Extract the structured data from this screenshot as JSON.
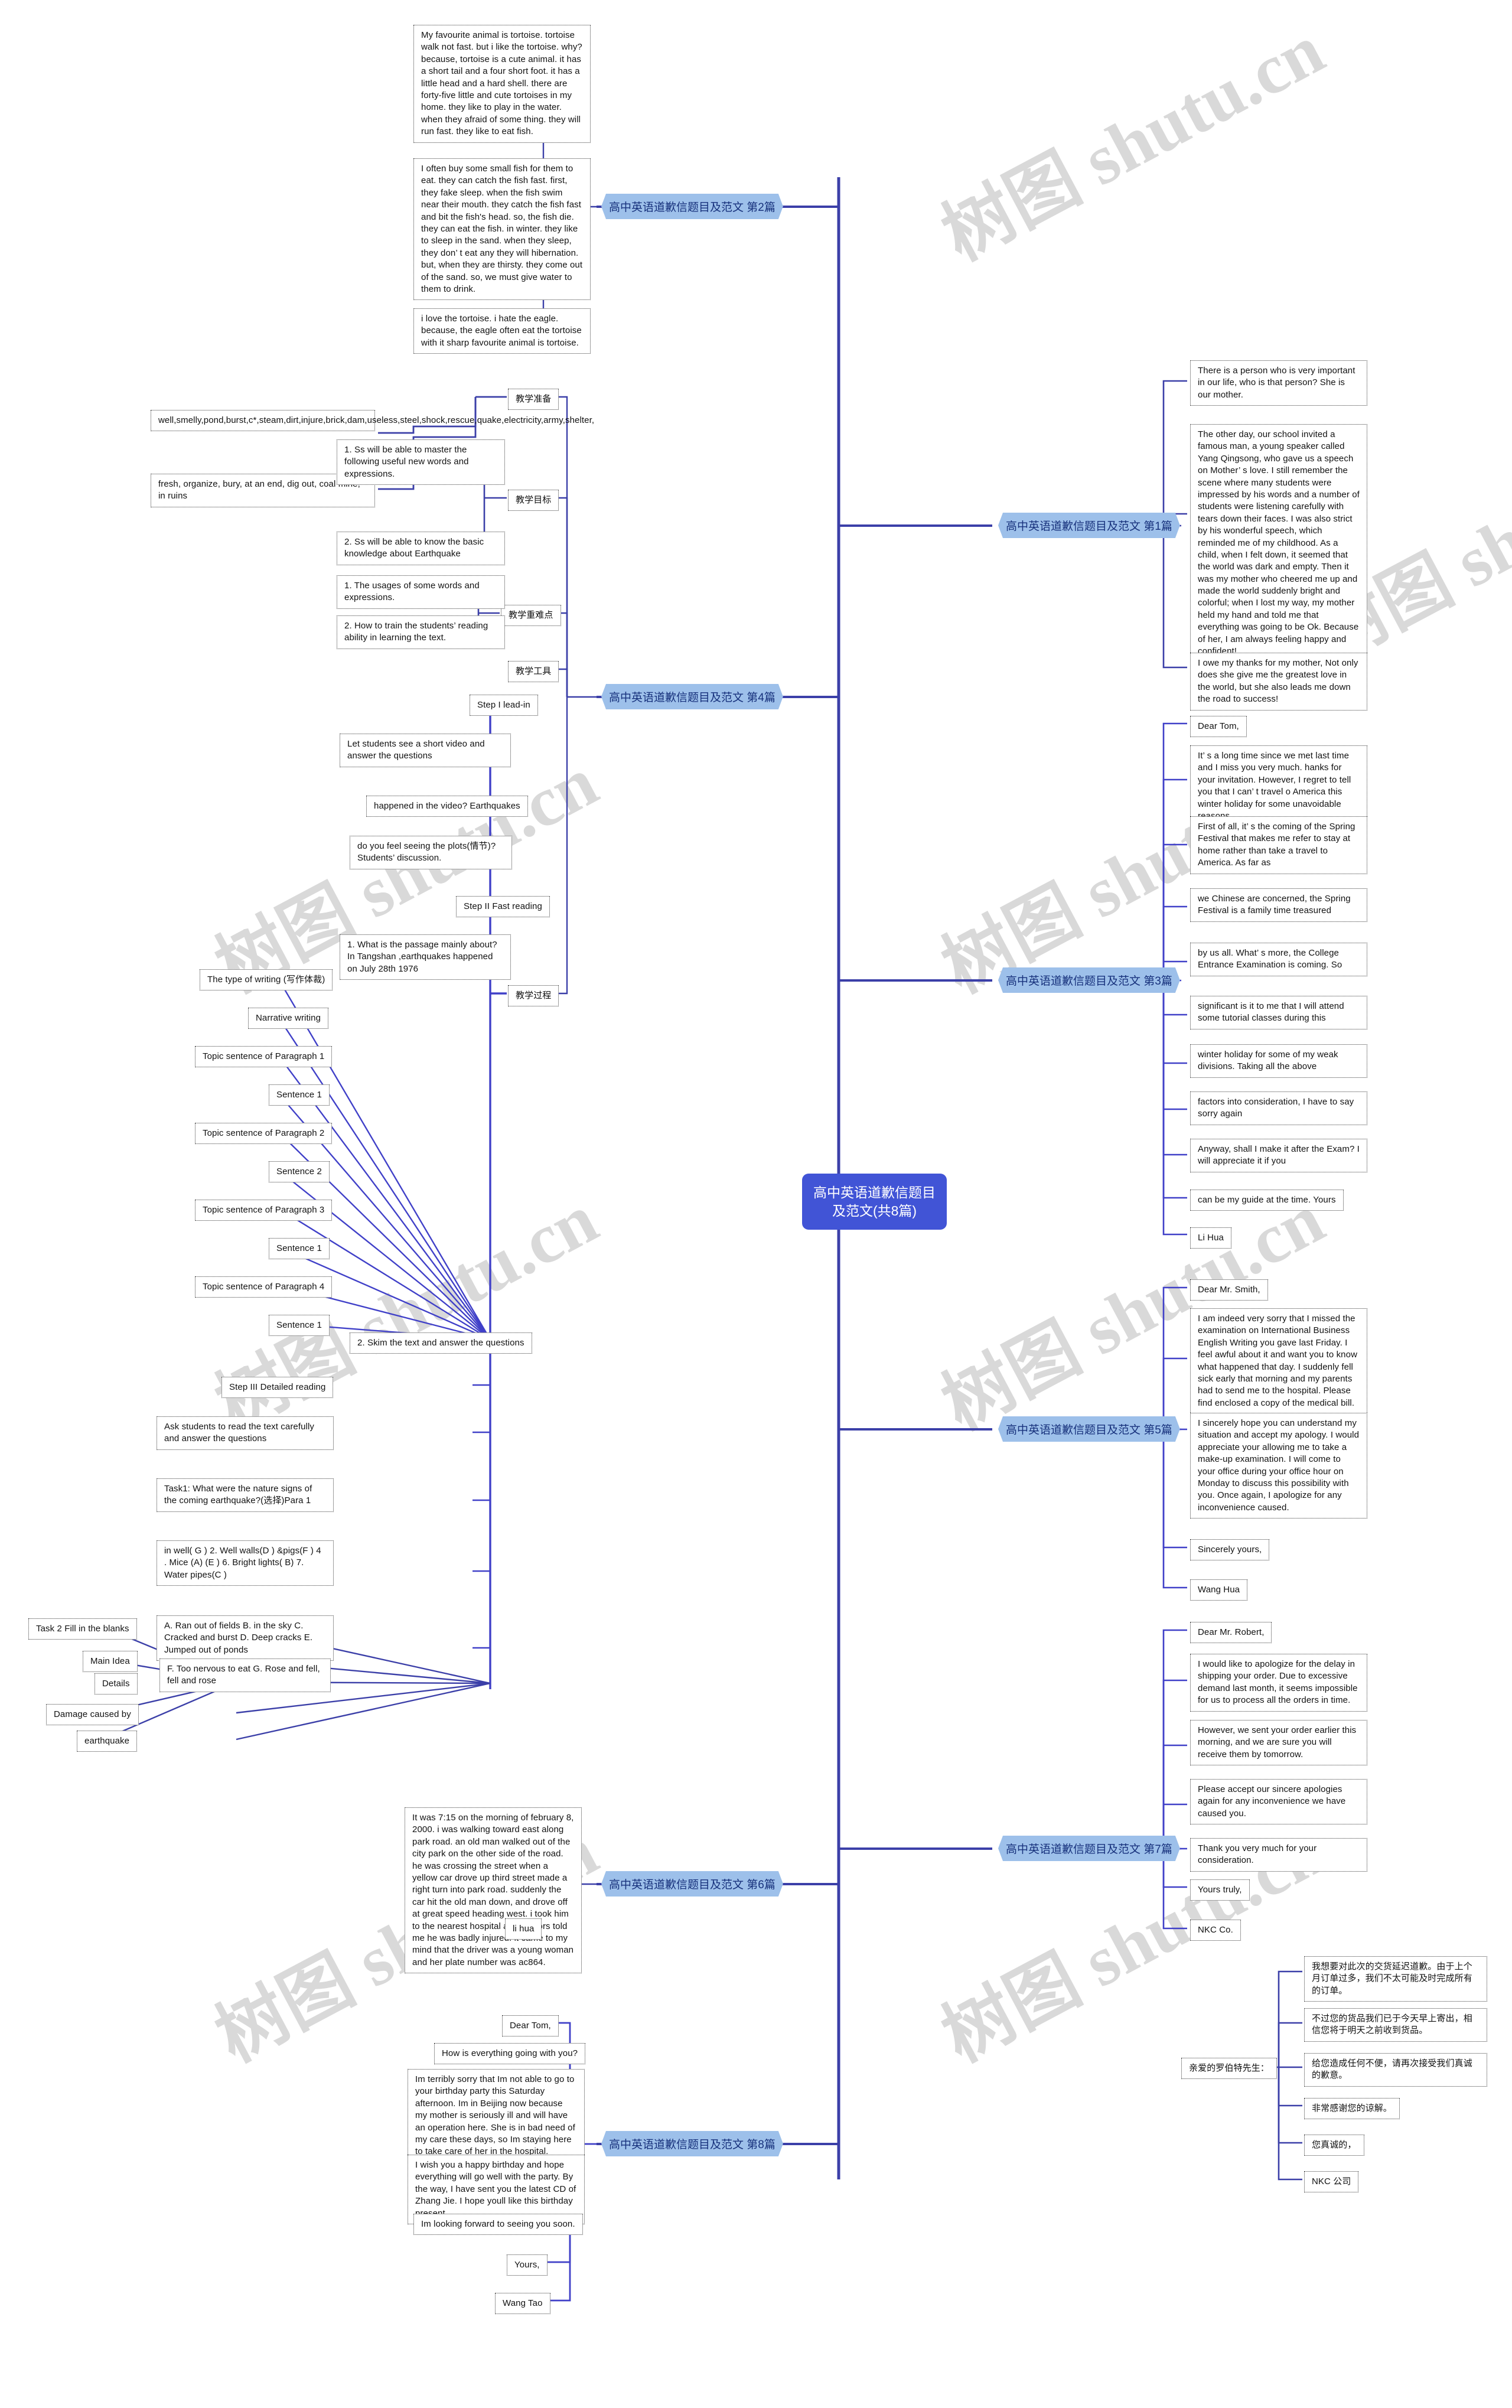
{
  "meta": {
    "title": "高中英语道歉信题目及范文(共8篇)",
    "accent_blue": "#4154d6",
    "branch_fill": "#9dc0ea",
    "branch_text": "#17317c",
    "node_border": "#3c3c3c",
    "watermark_text": "树图 shutu.cn"
  },
  "central": {
    "label": "高中英语道歉信题目及范文(共8篇)"
  },
  "watermarks": [
    "树图 shutu.cn",
    "树图 shutu.cn",
    "树图 shutu.cn",
    "树图 shutu.cn",
    "树图 shutu.cn",
    "树图 shutu.cn",
    "树图 shutu.cn",
    "树图 shutu.cn"
  ],
  "branches": {
    "b1": "高中英语道歉信题目及范文 第1篇",
    "b2": "高中英语道歉信题目及范文 第2篇",
    "b3": "高中英语道歉信题目及范文 第3篇",
    "b4": "高中英语道歉信题目及范文 第4篇",
    "b5": "高中英语道歉信题目及范文 第5篇",
    "b6": "高中英语道歉信题目及范文 第6篇",
    "b7": "高中英语道歉信题目及范文 第7篇",
    "b8": "高中英语道歉信题目及范文 第8篇"
  },
  "piece2": {
    "p1": "My favourite animal is tortoise. tortoise walk not fast. but i like the tortoise. why? because, tortoise is a cute animal. it has a short tail and a four short foot. it has a little head and a hard shell. there are forty-five little and cute tortoises in my home. they like to play in the water. when they afraid of some thing. they will run fast. they like to eat fish.",
    "p2": "I often buy some small fish for them to eat. they can catch the fish fast. first, they fake sleep. when the fish swim near their mouth. they catch the fish fast and bit the fish's head. so, the fish die. they can eat the fish. in winter. they like to sleep in the sand. when they sleep, they don’ t eat any  they will hibernation. but, when they are thirsty. they come out of the sand. so, we must give water to them to drink.",
    "p3": "i love the tortoise. i hate the eagle. because, the eagle often eat the tortoise with it sharp  favourite animal is tortoise."
  },
  "piece4": {
    "prep_label": "教学准备",
    "goal_label": "教学目标",
    "focus_label": "教学重难点",
    "tool_label": "教学工具",
    "process_label": "教学过程",
    "vocab1": "well,smelly,pond,burst,c*,steam,dirt,injure,brick,dam,useless,steel,shock,rescue,quake,electricity,army,shelter,",
    "vocab2": "fresh, organize, bury, at an end, dig out, coal mine, in ruins",
    "goal1": "1. Ss will be able to master the following useful new words and expressions.",
    "goal2": "2. Ss will be able to know the basic knowledge about Earthquake",
    "focus1": "1. The usages of some words and expressions.",
    "focus2": "2. How to train the students’    reading ability in learning the text.",
    "step1": "Step I lead-in",
    "step1a": "Let students see a short video and answer the questions",
    "step1b": "happened in the video? Earthquakes",
    "step1c": "do you feel seeing the plots(情节)? Students’   discussion.",
    "step2": "Step II Fast reading",
    "step2a": "1. What is the passage mainly about? In Tangshan ,earthquakes happened on July 28th 1976",
    "step2b": "2. Skim the text and answer the questions",
    "w1": "The type of writing (写作体裁)",
    "w2": "Narrative writing",
    "w3": "Topic sentence of Paragraph 1",
    "w4": "Sentence 1",
    "w5": "Topic sentence of Paragraph 2",
    "w6": "Sentence 2",
    "w7": "Topic sentence of Paragraph 3",
    "w8": "Sentence 1",
    "w9": "Topic sentence of Paragraph 4",
    "w10": "Sentence 1",
    "step3": "Step III Detailed reading",
    "step3a": "Ask students to read the text carefully and answer the questions",
    "step3b": "Task1: What were the nature signs of the coming earthquake?(选择)Para 1",
    "step3c": "in well( G ) 2. Well walls(D )  &pigs(F ) 4 . Mice (A) (E ) 6. Bright lights( B) 7. Water pipes(C )",
    "step3d": "A. Ran out of fields B. in the sky C. Cracked and burst D. Deep cracks E. Jumped out of ponds",
    "t1": "Task 2 Fill in the blanks",
    "t2": "Main Idea",
    "t3": "Details",
    "t4": "Damage caused by",
    "t5": "earthquake",
    "t6": "F. Too nervous to eat G. Rose and fell, fell and rose"
  },
  "piece1": {
    "p1": "There is a person who is very important in our life, who is that person? She is our mother.",
    "p2": "The other day, our school invited a famous man, a young speaker called Yang Qingsong, who gave us a speech on  Mother’  s love. I still remember the scene where many students were impressed by his words and a number of students were listening carefully with tears down their faces. I was also strict by  his wonderful speech, which reminded me of my childhood. As a child, when I felt down, it seemed that the world was dark and empty. Then it was my mother who cheered me up and made the world suddenly bright and colorful; when I lost my way, my mother held my hand and told me that everything was going to be Ok. Because of her, I am always feeling happy and confident!",
    "p3": "I owe my thanks for my mother, Not only  does she give me the greatest love in the world, but she also leads me down the road to success!"
  },
  "piece3": {
    "p1": "Dear Tom,",
    "p2": "It’  s a long time since we met last time and I miss you very much. hanks for your invitation. However, I regret to tell you that I can’  t travel o America this winter holiday for some unavoidable reasons.",
    "p3": "First of all, it’  s the coming of the Spring Festival that makes me refer to stay at home rather than take a travel to America. As far as",
    "p4": "we Chinese are concerned, the Spring Festival is a family time treasured",
    "p5": "by us all. What’  s more, the College Entrance Examination is coming. So",
    "p6": "significant is it to me that I will attend some tutorial classes during this",
    "p7": "winter holiday for some of my weak divisions. Taking all the above",
    "p8": "factors into consideration, I have to say sorry again",
    "p9": "Anyway, shall I make it after the Exam? I will appreciate it if you",
    "p10": "can be my guide at the time. Yours",
    "p11": "Li Hua"
  },
  "piece5": {
    "p1": "Dear Mr. Smith,",
    "p2": "I am indeed very sorry that I missed the examination on International Business English Writing you gave last Friday. I feel  awful about it and want you to know what happened that day. I suddenly fell sick early that morning and my parents had to send me to the hospital. Please find enclosed a copy of the medical bill.",
    "p3": "I sincerely hope you can understand my situation and accept my apology. I would  appreciate your allowing me to take a make-up examination. I will come to your  office during your office hour on Monday to discuss this possibility with you. Once again, I apologize for any inconvenience caused.",
    "p4": "Sincerely yours,",
    "p5": "Wang Hua"
  },
  "piece7": {
    "p1": "Dear Mr. Robert,",
    "p2": "I would like to apologize for the delay in shipping your order. Due to excessive demand last month, it seems impossible for us to process all the orders in time.",
    "p3": "However, we sent your order earlier this morning, and we are sure you will receive  them by tomorrow.",
    "p4": "Please accept our sincere apologies again  for any inconvenience we have caused you.",
    "p5": "Thank you very much for your consideration.",
    "p6": "Yours truly,",
    "p7": "NKC Co.",
    "c0": "亲爱的罗伯特先生：",
    "c1": "我想要对此次的交货延迟道歉。由于上个月订单过多，我们不太可能及时完成所有的订单。",
    "c2": "不过您的货品我们已于今天早上寄出，相信您将于明天之前收到货品。",
    "c3": "给您造成任何不便，请再次接受我们真诚的歉意。",
    "c4": "非常感谢您的谅解。",
    "c5": "您真诚的，",
    "c6": "NKC 公司"
  },
  "piece6": {
    "p1": "It was 7:15 on the morning of february 8, 2000. i was walking toward east along park road. an old man walked out of the city park on the other side of the road. he was crossing the street when a yellow car drove up third street made a right turn into park road. suddenly the car hit the old man down, and drove off at great speed heading west. i took him to the nearest hospital and doctors told me he was badly injured. it came to my mind that the driver was a young woman and her plate number was ac864.",
    "p2": "li hua"
  },
  "piece8": {
    "p1": "Dear Tom,",
    "p2": "How is everything going with you?",
    "p3": "Im terribly sorry that Im not able to go to your birthday party this Saturday afternoon. Im in Beijing now because my mother is seriously ill and will have an operation here. She is in bad need of my care these days, so Im staying here to take care of her in the hospital.",
    "p4": "I wish you a happy birthday and hope everything will go well with the party. By the way, I have sent you the latest CD of Zhang Jie. I hope youll like this birthday present.",
    "p5": "Im looking forward to seeing you soon.",
    "p6": "Yours,",
    "p7": "Wang Tao"
  }
}
